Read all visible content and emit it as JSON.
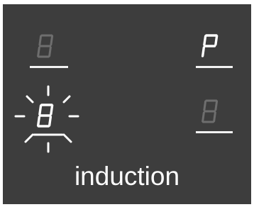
{
  "display": {
    "brand_label": "induction",
    "colors": {
      "panel_background": "#3d3d3d",
      "lit_segment": "#ffffff",
      "dim_segment": "#6e6e6e",
      "underline": "#f2f2f2"
    },
    "zones": [
      {
        "id": "top-left",
        "glyph": "8",
        "state": "dim"
      },
      {
        "id": "top-right",
        "glyph": "P",
        "state": "lit"
      },
      {
        "id": "middle-left",
        "glyph": "8",
        "state": "flashing"
      },
      {
        "id": "middle-right",
        "glyph": "8",
        "state": "dim"
      }
    ]
  }
}
